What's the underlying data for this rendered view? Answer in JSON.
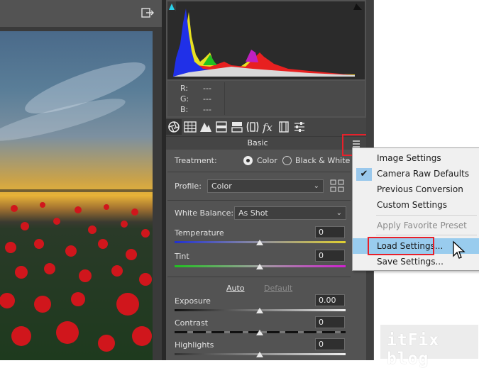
{
  "panel": {
    "readout": {
      "r_label": "R:",
      "r_value": "---",
      "g_label": "G:",
      "g_value": "---",
      "b_label": "B:",
      "b_value": "---"
    },
    "section_title": "Basic",
    "treatment": {
      "label": "Treatment:",
      "option_color": "Color",
      "option_bw": "Black & White",
      "selected": "Color"
    },
    "profile": {
      "label": "Profile:",
      "value": "Color"
    },
    "white_balance": {
      "label": "White Balance:",
      "value": "As Shot"
    },
    "temperature": {
      "label": "Temperature",
      "value": "0",
      "level": 0.5
    },
    "tint": {
      "label": "Tint",
      "value": "0",
      "level": 0.5
    },
    "auto_label": "Auto",
    "default_label": "Default",
    "exposure": {
      "label": "Exposure",
      "value": "0.00",
      "level": 0.5
    },
    "contrast": {
      "label": "Contrast",
      "value": "0",
      "level": 0.5
    },
    "highlights": {
      "label": "Highlights",
      "value": "0",
      "level": 0.5
    }
  },
  "menu": {
    "items": [
      {
        "label": "Image Settings",
        "checked": false,
        "disabled": false
      },
      {
        "label": "Camera Raw Defaults",
        "checked": true,
        "disabled": false
      },
      {
        "label": "Previous Conversion",
        "checked": false,
        "disabled": false
      },
      {
        "label": "Custom Settings",
        "checked": false,
        "disabled": false
      },
      {
        "label": "Apply Favorite Preset",
        "checked": false,
        "disabled": true
      },
      {
        "label": "Load Settings...",
        "checked": false,
        "disabled": false,
        "hover": true
      },
      {
        "label": "Save Settings...",
        "checked": false,
        "disabled": false
      }
    ]
  },
  "watermark": "itFix blog",
  "colors": {
    "accent_red": "#e8202a",
    "menu_hover": "#99ccee",
    "panel_bg": "#535353"
  },
  "icons": [
    "export-icon",
    "basic-aperture-icon",
    "tone-curve-grid-icon",
    "detail-triangle-icon",
    "hsl-icon",
    "split-toning-icon",
    "lens-icon",
    "fx-icon",
    "camera-calibration-icon",
    "presets-sliders-icon",
    "panel-menu-icon",
    "profile-grid-icon",
    "checkmark-icon",
    "mouse-cursor-icon"
  ]
}
